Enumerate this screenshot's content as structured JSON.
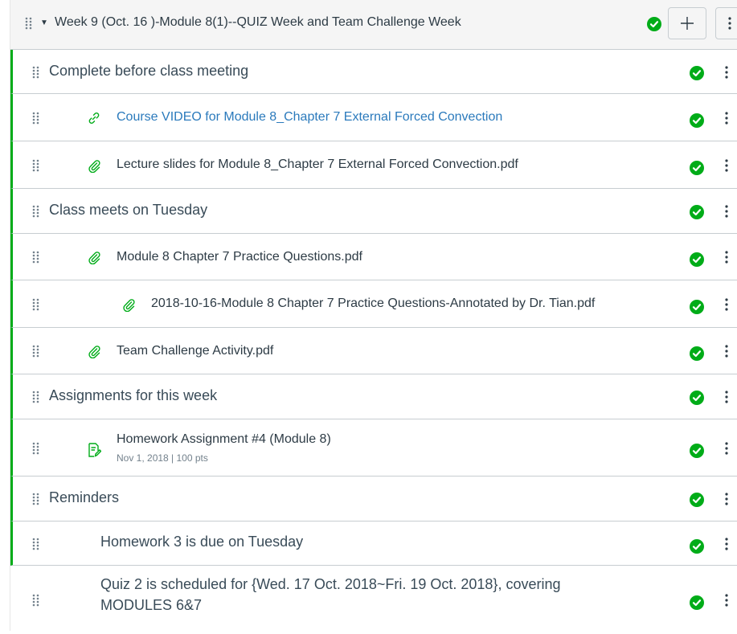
{
  "module": {
    "title": "Week 9 (Oct. 16 )-Module 8(1)--QUIZ Week and Team Challenge Week",
    "add_label": "+",
    "more_label": "⋮"
  },
  "items": [
    {
      "kind": "header",
      "label": "Complete before class meeting"
    },
    {
      "kind": "link",
      "icon": "link-icon",
      "label": "Course VIDEO for Module 8_Chapter 7 External Forced Convection"
    },
    {
      "kind": "file",
      "icon": "paperclip-icon",
      "label": "Lecture slides for Module 8_Chapter 7 External Forced Convection.pdf"
    },
    {
      "kind": "header",
      "label": "Class meets on Tuesday"
    },
    {
      "kind": "file",
      "icon": "paperclip-icon",
      "label": "Module 8 Chapter 7 Practice Questions.pdf"
    },
    {
      "kind": "file",
      "icon": "paperclip-icon",
      "label": "2018-10-16-Module 8 Chapter 7 Practice Questions-Annotated by Dr. Tian.pdf"
    },
    {
      "kind": "file",
      "icon": "paperclip-icon",
      "label": "Team Challenge Activity.pdf"
    },
    {
      "kind": "header",
      "label": "Assignments for this week"
    },
    {
      "kind": "assignment",
      "icon": "assignment-icon",
      "label": "Homework Assignment #4 (Module 8)",
      "meta": "Nov 1, 2018  |  100 pts"
    },
    {
      "kind": "header",
      "label": "Reminders"
    },
    {
      "kind": "subheader",
      "label": "Homework 3 is due on Tuesday"
    },
    {
      "kind": "subheader",
      "label": "Quiz 2 is scheduled for {Wed. 17 Oct. 2018~Fri. 19 Oct. 2018}, covering MODULES 6&7"
    }
  ],
  "colors": {
    "published": "#00ac18",
    "link": "#2b7abc",
    "text": "#2d3b45"
  }
}
